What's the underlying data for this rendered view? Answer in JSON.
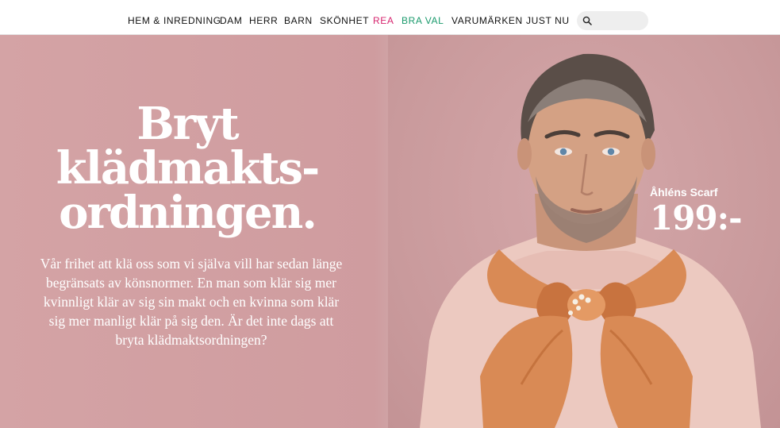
{
  "nav": {
    "items": [
      {
        "label": "HEM & INREDNING",
        "color": "#111111"
      },
      {
        "label": "DAM",
        "color": "#111111"
      },
      {
        "label": "HERR",
        "color": "#111111"
      },
      {
        "label": "BARN",
        "color": "#111111"
      },
      {
        "label": "SKÖNHET",
        "color": "#111111"
      },
      {
        "label": "REA",
        "color": "#d6246e"
      },
      {
        "label": "BRA VAL",
        "color": "#1a9a6c"
      },
      {
        "label": "VARUMÄRKEN",
        "color": "#111111"
      },
      {
        "label": "JUST NU",
        "color": "#111111"
      }
    ],
    "search": {
      "icon": "search-icon",
      "placeholder": ""
    }
  },
  "hero": {
    "headline_lines": [
      "Bryt",
      "klädmakts-",
      "ordningen."
    ],
    "body": "Vår frihet att klä oss som vi själva vill har sedan länge begränsats av könsnormer. En man som klär sig mer kvinnligt klär av sig sin makt och en kvinna som klär sig mer manligt klär på sig den. Är det inte dags att bryta klädmaktsordningen?",
    "product": {
      "name": "Åhléns Scarf",
      "price": "199:-"
    },
    "colors": {
      "background": "#d4a3a5",
      "scarf": "#d98a55",
      "text": "#ffffff"
    }
  }
}
